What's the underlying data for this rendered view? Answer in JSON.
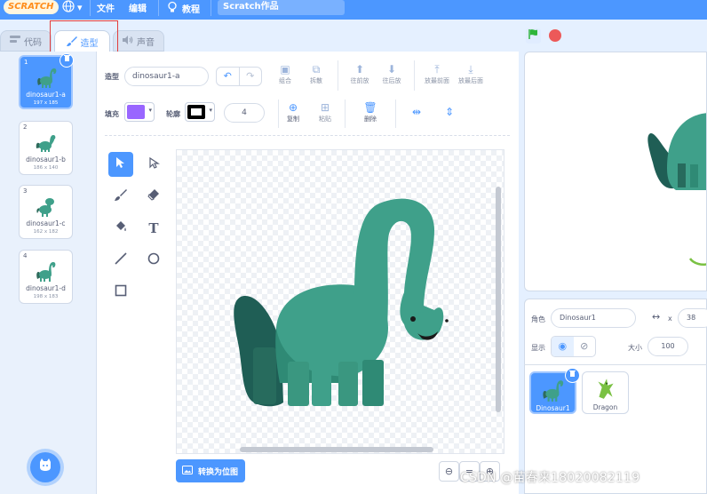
{
  "menubar": {
    "logo": "SCRATCH",
    "globe": "▾",
    "file": "文件",
    "edit": "编辑",
    "tutorials": "教程",
    "project_title": "Scratch作品",
    "color": "#4c97ff"
  },
  "tabs": {
    "code": "代码",
    "costumes": "造型",
    "sounds": "声音"
  },
  "costumes": [
    {
      "num": "1",
      "name": "dinosaur1-a",
      "size": "197 x 185",
      "selected": true
    },
    {
      "num": "2",
      "name": "dinosaur1-b",
      "size": "186 x 140",
      "selected": false
    },
    {
      "num": "3",
      "name": "dinosaur1-c",
      "size": "162 x 182",
      "selected": false
    },
    {
      "num": "4",
      "name": "dinosaur1-d",
      "size": "198 x 183",
      "selected": false
    }
  ],
  "editor": {
    "costume_label": "造型",
    "costume_name": "dinosaur1-a",
    "group": "组合",
    "ungroup": "拆散",
    "forward": "往前放",
    "backward": "往后放",
    "front": "放最前面",
    "back": "放最后面",
    "fill_label": "填充",
    "outline_label": "轮廓",
    "stroke_width": "4",
    "copy": "复制",
    "paste": "粘贴",
    "delete": "删除",
    "fill_color": "#9966ff",
    "outline_color": "#000000",
    "convert_bitmap": "转换为位图"
  },
  "sprite_info": {
    "sprite_label": "角色",
    "sprite_name": "Dinosaur1",
    "x_label": "x",
    "x_value": "38",
    "show_label": "显示",
    "size_label": "大小",
    "size_value": "100"
  },
  "sprites": [
    {
      "name": "Dinosaur1",
      "selected": true
    },
    {
      "name": "Dragon",
      "selected": false
    }
  ],
  "watermark": "CSDN @苗春来18020082119"
}
